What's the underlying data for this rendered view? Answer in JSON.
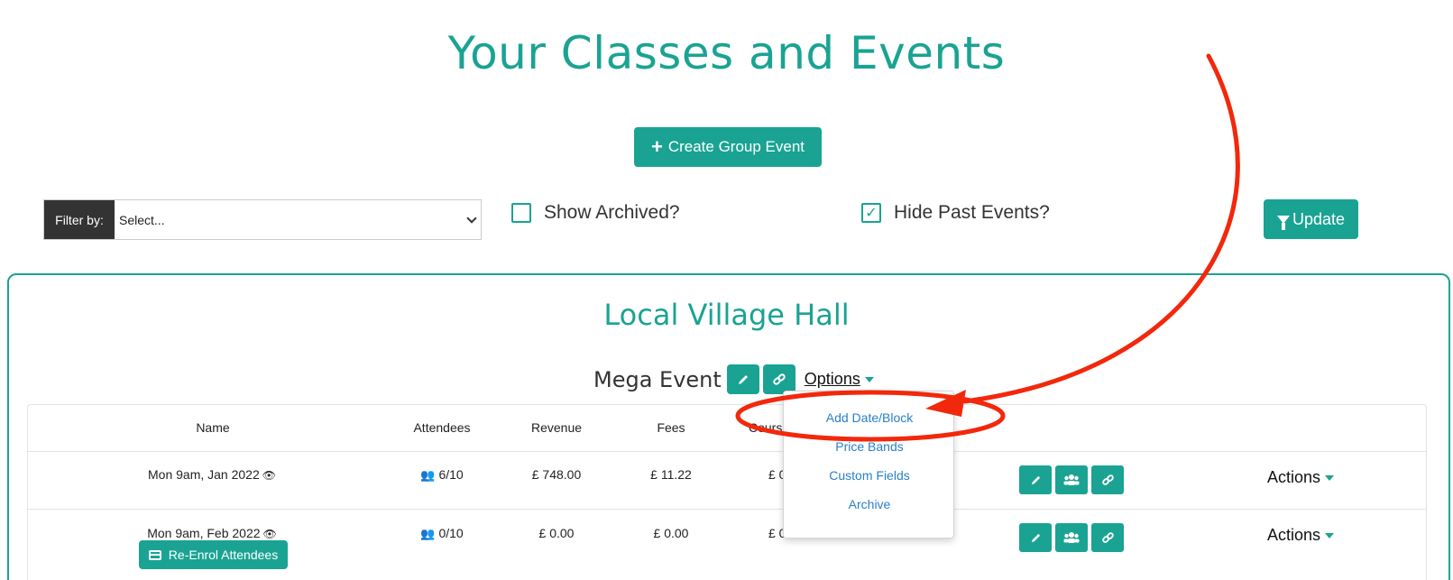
{
  "page": {
    "title": "Your Classes and Events"
  },
  "toolbar": {
    "create_label": "Create Group Event",
    "filter_label": "Filter by:",
    "filter_value": "Select...",
    "show_archived_label": "Show Archived?",
    "show_archived_checked": false,
    "hide_past_label": "Hide Past Events?",
    "hide_past_checked": true,
    "update_label": "Update"
  },
  "venue": {
    "name": "Local Village Hall",
    "event": {
      "name": "Mega Event",
      "options_label": "Options",
      "options_menu": [
        "Add Date/Block",
        "Price Bands",
        "Custom Fields",
        "Archive"
      ]
    },
    "table": {
      "columns": [
        "Name",
        "Attendees",
        "Revenue",
        "Fees",
        "Course"
      ],
      "rows": [
        {
          "name": "Mon 9am, Jan 2022",
          "attendees": "6/10",
          "revenue": "£ 748.00",
          "fees": "£ 11.22",
          "course": "£ 0",
          "actions": "Actions"
        },
        {
          "name": "Mon 9am, Feb 2022",
          "attendees": "0/10",
          "revenue": "£ 0.00",
          "fees": "£ 0.00",
          "course": "£ 0",
          "actions": "Actions",
          "reenrol_label": "Re-Enrol Attendees"
        }
      ]
    }
  },
  "colors": {
    "accent": "#1aa393",
    "annotation": "#f2280c",
    "link": "#2a7fc6"
  },
  "icons": [
    "plus-icon",
    "filter-icon",
    "check-icon",
    "pencil-icon",
    "link-icon",
    "users-icon",
    "eye-icon",
    "credit-card-icon",
    "caret-down-icon"
  ]
}
